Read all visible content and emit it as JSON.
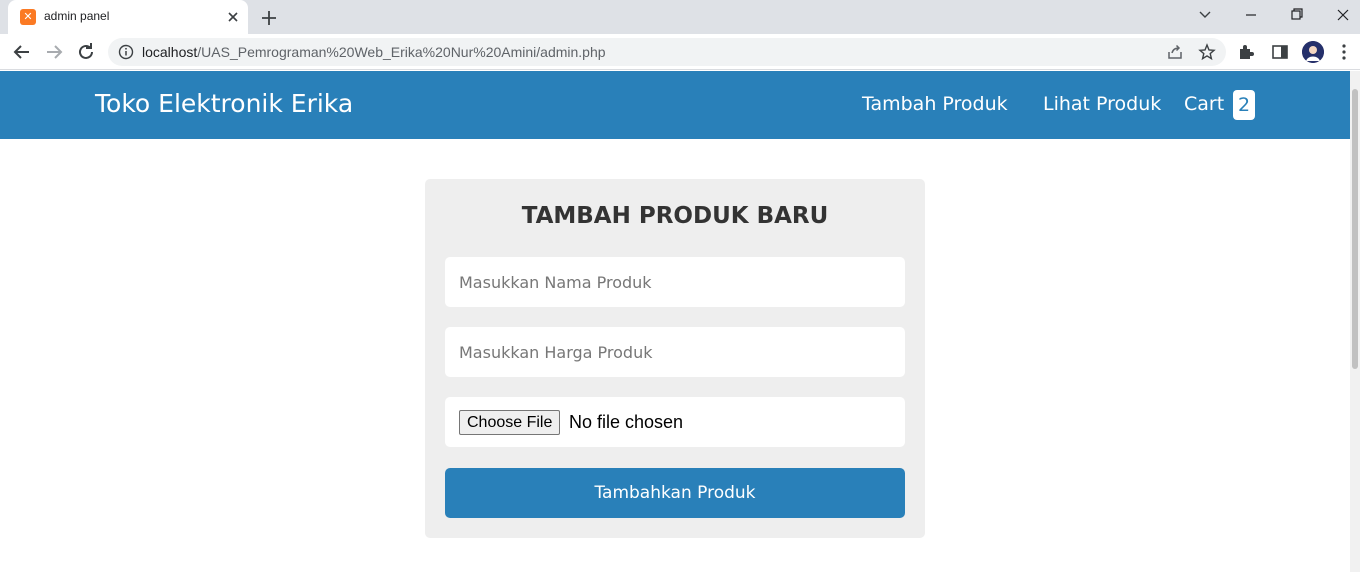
{
  "browser": {
    "tab_title": "admin panel",
    "url_host": "localhost",
    "url_path": "/UAS_Pemrograman%20Web_Erika%20Nur%20Amini/admin.php"
  },
  "header": {
    "brand": "Toko Elektronik Erika",
    "nav_add": "Tambah Produk",
    "nav_view": "Lihat Produk",
    "nav_cart": "Cart",
    "cart_count": "2"
  },
  "form": {
    "title": "TAMBAH PRODUK BARU",
    "name_placeholder": "Masukkan Nama Produk",
    "price_placeholder": "Masukkan Harga Produk",
    "file_button": "Choose File",
    "file_status": "No file chosen",
    "submit_label": "Tambahkan Produk"
  },
  "colors": {
    "header_bg": "#2980b9",
    "card_bg": "#eeeeee",
    "button_bg": "#2980b9"
  }
}
